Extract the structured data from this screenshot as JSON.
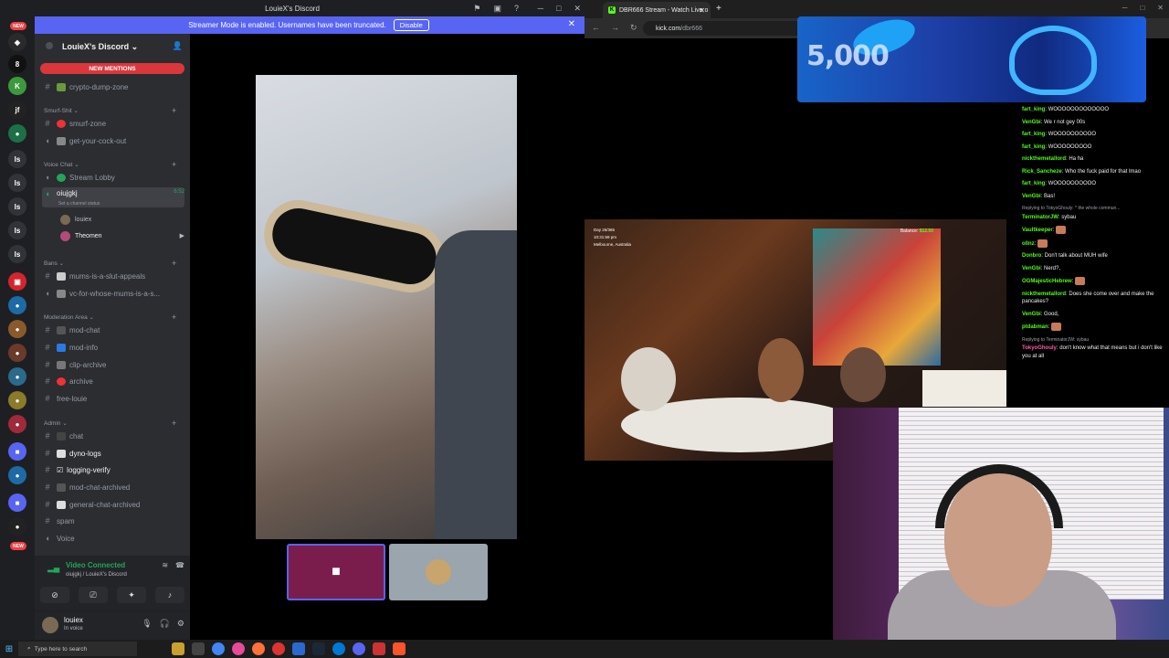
{
  "discord": {
    "window_title": "LouieX's Discord",
    "banner_text": "Streamer Mode is enabled. Usernames have been truncated.",
    "banner_button": "Disable",
    "server_name": "LouieX's Discord",
    "new_mentions": "NEW MENTIONS",
    "rail_new_top": "NEW",
    "rail_new_bottom": "NEW",
    "channels": [
      {
        "type": "text",
        "name": "crypto-dump-zone"
      },
      {
        "type": "category",
        "name": "Smurf-Shit"
      },
      {
        "type": "text",
        "name": "smurf-zone"
      },
      {
        "type": "voice",
        "name": "get-your-cock-out"
      },
      {
        "type": "category",
        "name": "Voice Chat"
      },
      {
        "type": "voice",
        "name": "Stream Lobby"
      },
      {
        "type": "voice",
        "name": "oiujgkj",
        "status": "Set a channel status",
        "time": "6:52"
      },
      {
        "type": "member",
        "name": "louiex"
      },
      {
        "type": "member",
        "name": "Theomen"
      },
      {
        "type": "category",
        "name": "Bans"
      },
      {
        "type": "text",
        "name": "mums-is-a-slut-appeals"
      },
      {
        "type": "voice",
        "name": "vc-for-whose-mums-is-a-s..."
      },
      {
        "type": "category",
        "name": "Moderation Area"
      },
      {
        "type": "text",
        "name": "mod-chat"
      },
      {
        "type": "text",
        "name": "mod-info"
      },
      {
        "type": "text",
        "name": "clip-archive"
      },
      {
        "type": "text",
        "name": "archive"
      },
      {
        "type": "text",
        "name": "free-louie"
      },
      {
        "type": "category",
        "name": "Admin"
      },
      {
        "type": "text",
        "name": "chat"
      },
      {
        "type": "text",
        "name": "dyno-logs"
      },
      {
        "type": "text",
        "name": "logging-verify"
      },
      {
        "type": "text",
        "name": "mod-chat-archived"
      },
      {
        "type": "text",
        "name": "general-chat-archived"
      },
      {
        "type": "text",
        "name": "spam"
      },
      {
        "type": "voice",
        "name": "Voice"
      }
    ],
    "voice_connected": "Video Connected",
    "voice_location": "oiujgkj / LouieX's Discord",
    "user_name": "louiex",
    "user_status": "In voice",
    "colors": {
      "blurple": "#5865f2",
      "red": "#da373c",
      "green": "#23a55a"
    }
  },
  "browser": {
    "tab_title": "DBR666 Stream - Watch Live o",
    "url_domain": "kick.com",
    "url_path": "/dbr666",
    "promo_amount": "5,000",
    "stream_info": [
      "Day 26/365",
      "10:31:59 pm",
      "Melbourne, Australia"
    ],
    "balance_label": "Balance:",
    "balance_value": "$12.50",
    "chat": [
      {
        "user": "fart_king",
        "color": "#53fc18",
        "text": "WOOOOOOOOOOOOO"
      },
      {
        "user": "VenGbi",
        "color": "#53fc18",
        "text": "We r not gey 00s"
      },
      {
        "user": "fart_king",
        "color": "#53fc18",
        "text": "WOOOOOOOOOO"
      },
      {
        "user": "fart_king",
        "color": "#53fc18",
        "text": "WOOOOOOOOO"
      },
      {
        "user": "nickthemetallord",
        "color": "#53fc18",
        "text": "Ha ha"
      },
      {
        "user": "Rick_Sancheze",
        "color": "#53fc18",
        "text": "Who the fuck paid for that lmao"
      },
      {
        "user": "fart_king",
        "color": "#53fc18",
        "text": "WOOOOOOOOOO"
      },
      {
        "user": "VenGbi",
        "color": "#53fc18",
        "text": "Bas!"
      },
      {
        "reply": "Replying to TokyoGhouly: * the whole commun..."
      },
      {
        "user": "TerminatorJW",
        "color": "#53fc18",
        "text": "sybau"
      },
      {
        "user": "Vaultkeeper",
        "color": "#53fc18",
        "text": "",
        "emote": true
      },
      {
        "user": "ollnz",
        "color": "#53fc18",
        "text": "",
        "emote": true
      },
      {
        "user": "Donbro",
        "color": "#53fc18",
        "text": "Don't talk about MUH wife"
      },
      {
        "user": "VenGbi",
        "color": "#53fc18",
        "text": "Nerd?,"
      },
      {
        "user": "OGMajesticHebrew",
        "color": "#53fc18",
        "text": "",
        "emote": true
      },
      {
        "user": "nickthemetallord",
        "color": "#53fc18",
        "text": "Does she come over and make the pancakes?"
      },
      {
        "user": "VenGbi",
        "color": "#53fc18",
        "text": "Good,"
      },
      {
        "user": "ptdabman",
        "color": "#53fc18",
        "text": "",
        "emote": true
      },
      {
        "reply": "Replying to TerminatorJW: sybau"
      },
      {
        "user": "TokyoGhouly",
        "color": "#ff5ca8",
        "text": "don't know what that means but i don't like you at all"
      }
    ]
  },
  "taskbar": {
    "search_placeholder": "Type here to search"
  }
}
